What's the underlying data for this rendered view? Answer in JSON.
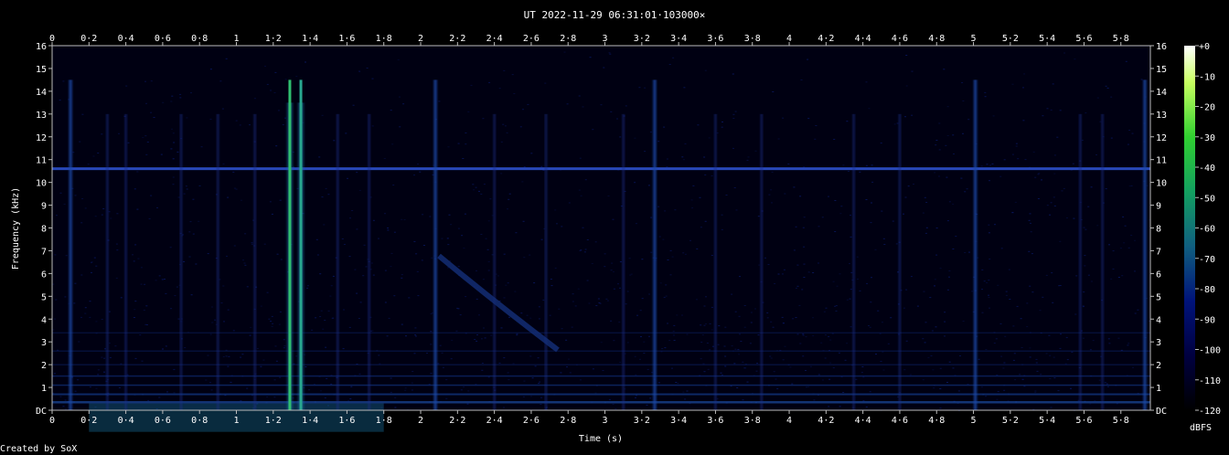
{
  "chart_data": {
    "type": "heatmap",
    "title": "UT 2022-11-29 06:31:01·103000×",
    "xlabel": "Time (s)",
    "ylabel": "Frequency (kHz)",
    "xlim": [
      0,
      5.96
    ],
    "ylim": [
      0,
      16
    ],
    "x_ticks": [
      "0",
      "0·2",
      "0·4",
      "0·6",
      "0·8",
      "1",
      "1·2",
      "1·4",
      "1·6",
      "1·8",
      "2",
      "2·2",
      "2·4",
      "2·6",
      "2·8",
      "3",
      "3·2",
      "3·4",
      "3·6",
      "3·8",
      "4",
      "4·2",
      "4·4",
      "4·6",
      "4·8",
      "5",
      "5·2",
      "5·4",
      "5·6",
      "5·8"
    ],
    "y_ticks": [
      "DC",
      "1",
      "2",
      "3",
      "4",
      "5",
      "6",
      "7",
      "8",
      "9",
      "10",
      "11",
      "12",
      "13",
      "14",
      "15",
      "16"
    ],
    "colorbar": {
      "label": "dBFS",
      "ticks": [
        "+0",
        "-10",
        "-20",
        "-30",
        "-40",
        "-50",
        "-60",
        "-70",
        "-80",
        "-90",
        "-100",
        "-110",
        "-120"
      ],
      "range_db": [
        -120,
        0
      ]
    },
    "colors": {
      "low": "#000030",
      "mid": "#1f8f8f",
      "high": "#ffffff",
      "line": "#1a2a8a"
    },
    "features": {
      "constant_tone_khz": 10.6,
      "strong_vertical_lines_s": [
        1.29,
        1.35
      ],
      "medium_vertical_lines_s": [
        0.1,
        2.08,
        3.27,
        5.01,
        5.93
      ],
      "faint_vertical_lines_s": [
        0.3,
        0.4,
        0.7,
        0.9,
        1.1,
        1.55,
        1.72,
        2.4,
        2.68,
        3.1,
        3.6,
        3.85,
        4.35,
        4.6,
        5.58,
        5.7
      ]
    }
  },
  "footer": {
    "credit": "Created by SoX"
  }
}
